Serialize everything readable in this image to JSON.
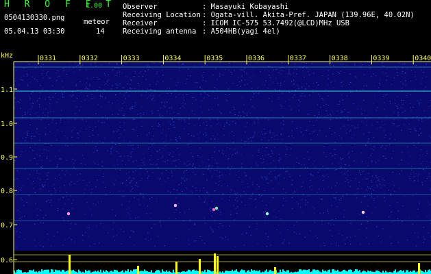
{
  "app": {
    "title": "H R O F F T",
    "version": "1.00",
    "file_name": "0504130330.png",
    "timestamp": "05.04.13 03:30",
    "counter_label": "meteor",
    "counter_value": "14"
  },
  "info": {
    "rows": [
      {
        "label": "Observer",
        "value": ": Masayuki Kobayashi"
      },
      {
        "label": "Receiving Location",
        "value": ": Ogata-vill. Akita-Pref. JAPAN (139.96E, 40.02N)"
      },
      {
        "label": "Receiver",
        "value": ": ICOM IC-575 53.7492(@LCD)MHz USB"
      },
      {
        "label": "Receiving antenna",
        "value": ": A504HB(yagi 4el)"
      }
    ]
  },
  "spectrogram": {
    "y_unit": "kHz",
    "y_ticks": [
      "1.1",
      "1.0",
      "0.9",
      "0.8",
      "0.7",
      "0.6"
    ],
    "time_ticks": [
      "0331",
      "0332",
      "0333",
      "0334",
      "0335",
      "0336",
      "0337",
      "0338",
      "0339",
      "0340"
    ],
    "colors": {
      "background": "#0a0a6e",
      "noise": "#3a5cff",
      "carrier": "#39e6e6",
      "axis": "#ffff55",
      "power": "#00ffff",
      "spike": "#ffff00"
    }
  }
}
